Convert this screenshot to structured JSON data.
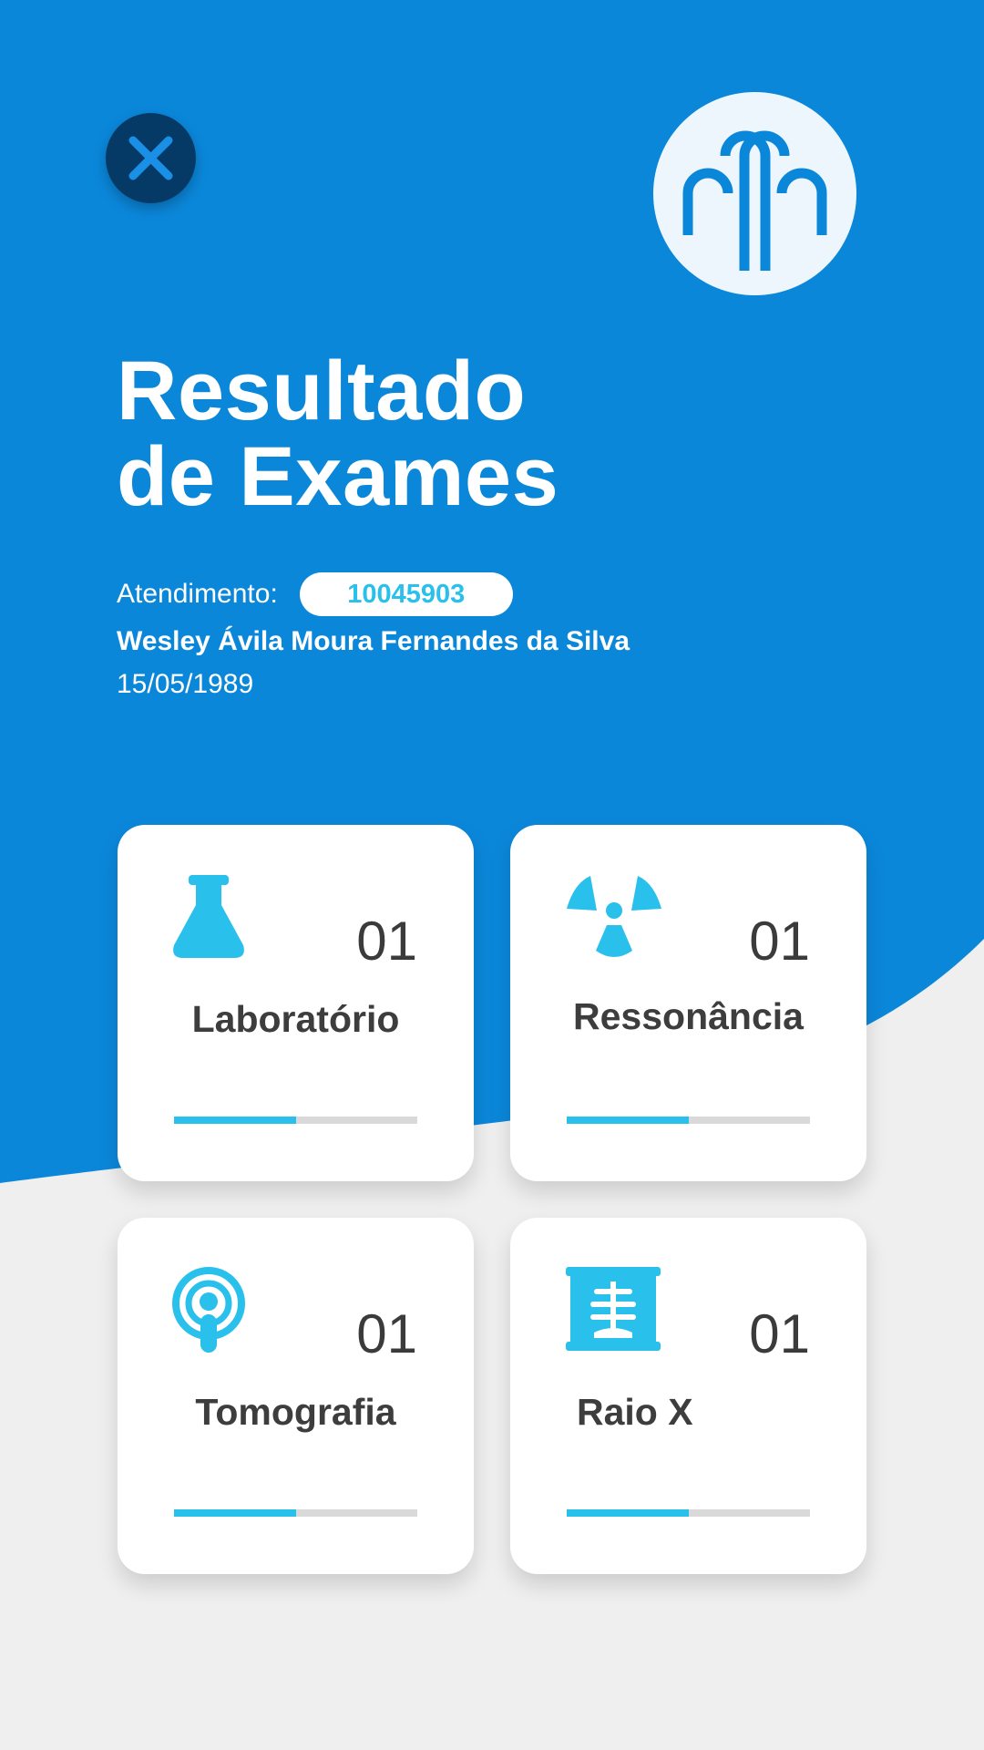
{
  "colors": {
    "header_blue": "#0b87da",
    "dark_navy": "#063a66",
    "accent_cyan": "#29c0ec",
    "background": "#efefef",
    "card_text": "#3d3d3d"
  },
  "header": {
    "close_icon": "close-icon",
    "logo_icon": "hospital-logo-icon",
    "title_line1": "Resultado",
    "title_line2": "de Exames"
  },
  "patient": {
    "attendance_label": "Atendimento:",
    "attendance_number": "10045903",
    "name": "Wesley Ávila Moura Fernandes da Silva",
    "birth_date": "15/05/1989"
  },
  "exams": [
    {
      "label": "Laboratório",
      "count": "01",
      "icon": "flask-icon",
      "progress": 0.5
    },
    {
      "label": "Ressonância",
      "count": "01",
      "icon": "radiation-icon",
      "progress": 0.5
    },
    {
      "label": "Tomografia",
      "count": "01",
      "icon": "scan-signal-icon",
      "progress": 0.5
    },
    {
      "label": "Raio X",
      "count": "01",
      "icon": "xray-icon",
      "progress": 0.5
    }
  ]
}
